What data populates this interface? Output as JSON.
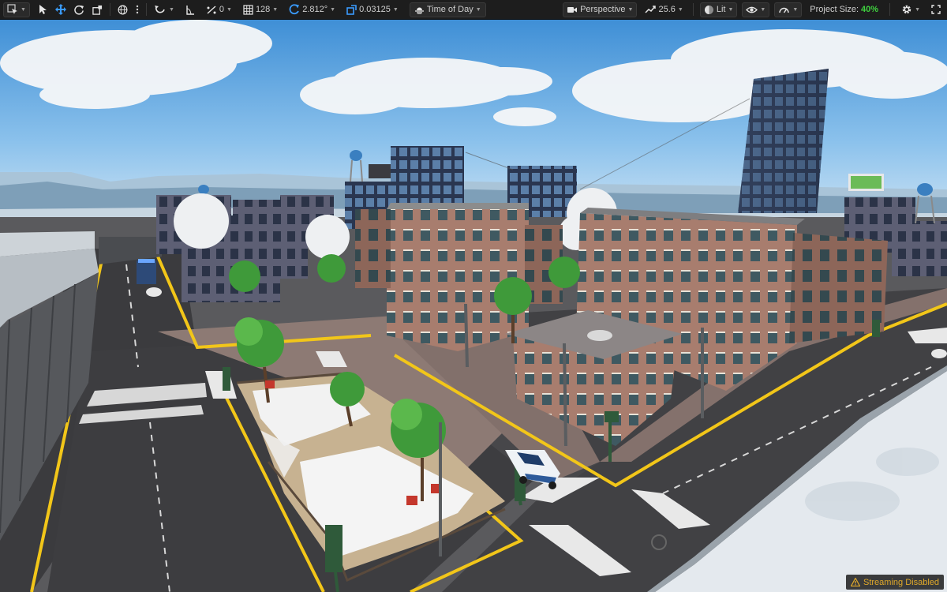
{
  "toolbar": {
    "select_mode_icon": "select-mode-icon",
    "snap_angle_label": "0",
    "grid_size_label": "128",
    "rotation_snap_label": "2.812°",
    "scale_snap_label": "0.03125",
    "time_of_day_label": "Time of Day",
    "perspective_label": "Perspective",
    "camera_speed_label": "25.6",
    "lit_label": "Lit",
    "project_size_label": "Project Size:",
    "project_size_value": "40%"
  },
  "viewport": {
    "streaming_status": "Streaming Disabled"
  },
  "colors": {
    "toolbar_bg": "#1d1d1d",
    "accent_blue": "#3a9bff",
    "project_size_green": "#3fd13f",
    "warning_orange": "#e0a92a",
    "sky": "#5aa6e0",
    "road_yellow": "#f2c619"
  }
}
